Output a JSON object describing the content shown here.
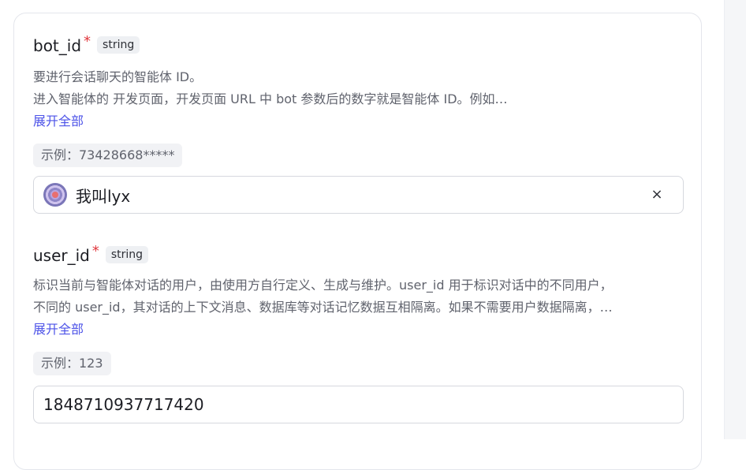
{
  "params": [
    {
      "name": "bot_id",
      "required_mark": "*",
      "type": "string",
      "desc_line1": "要进行会话聊天的智能体 ID。",
      "desc_line2": "进入智能体的 开发页面，开发页面 URL 中 bot 参数后的数字就是智能体 ID。例如…",
      "expand_label": "展开全部",
      "example": "示例：73428668*****",
      "value": "我叫lyx",
      "clear_icon": "×"
    },
    {
      "name": "user_id",
      "required_mark": "*",
      "type": "string",
      "desc_line1": "标识当前与智能体对话的用户，由使用方自行定义、生成与维护。user_id 用于标识对话中的不同用户，",
      "desc_line2": "不同的 user_id，其对话的上下文消息、数据库等对话记忆数据互相隔离。如果不需要用户数据隔离，…",
      "expand_label": "展开全部",
      "example": "示例：123",
      "value": "1848710937717420"
    }
  ]
}
